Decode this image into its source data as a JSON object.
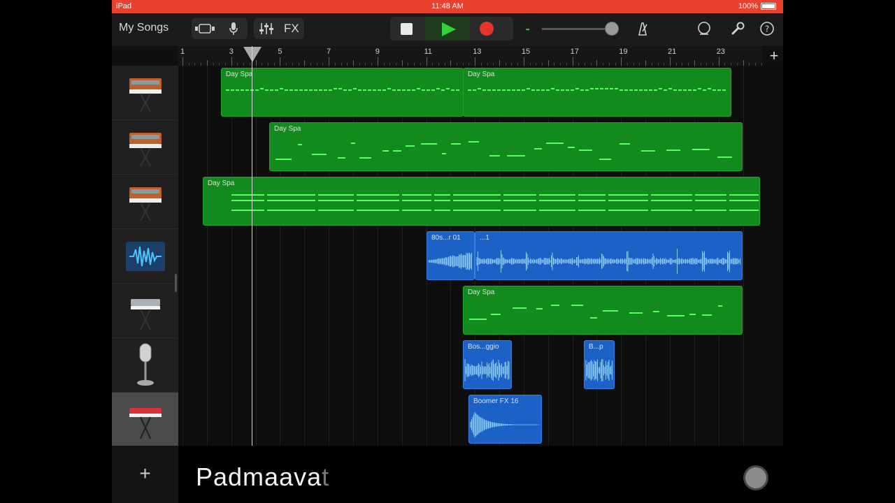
{
  "status_bar": {
    "device": "iPad",
    "time": "11:48 AM",
    "battery": "100%"
  },
  "toolbar": {
    "my_songs": "My Songs",
    "fx": "FX",
    "lcd_text": "▪▪"
  },
  "ruler": {
    "bars": [
      "1",
      "3",
      "5",
      "7",
      "9",
      "11",
      "13",
      "15",
      "17",
      "19",
      "21",
      "23"
    ]
  },
  "tracks": [
    {
      "instrument": "synth-keyboard"
    },
    {
      "instrument": "synth-keyboard"
    },
    {
      "instrument": "synth-keyboard"
    },
    {
      "instrument": "sampler-waveform"
    },
    {
      "instrument": "keyboard-silver"
    },
    {
      "instrument": "microphone"
    },
    {
      "instrument": "red-keyboard"
    }
  ],
  "regions": {
    "r1a": "Day Spa",
    "r1b": "Day Spa",
    "r2": "Day Spa",
    "r3": "Day Spa",
    "r4a": "80s...r 01",
    "r4b": "...1",
    "r5": "Day Spa",
    "r6a": "Bos...ggio",
    "r6b": "B...p",
    "r7": "Boomer FX 16"
  },
  "caption": {
    "main": "Padmaava",
    "faded": "t"
  },
  "colors": {
    "midi": "#138a1e",
    "audio": "#1c62c6",
    "status": "#e8412e",
    "play": "#2fd23a",
    "record": "#e5342a"
  }
}
